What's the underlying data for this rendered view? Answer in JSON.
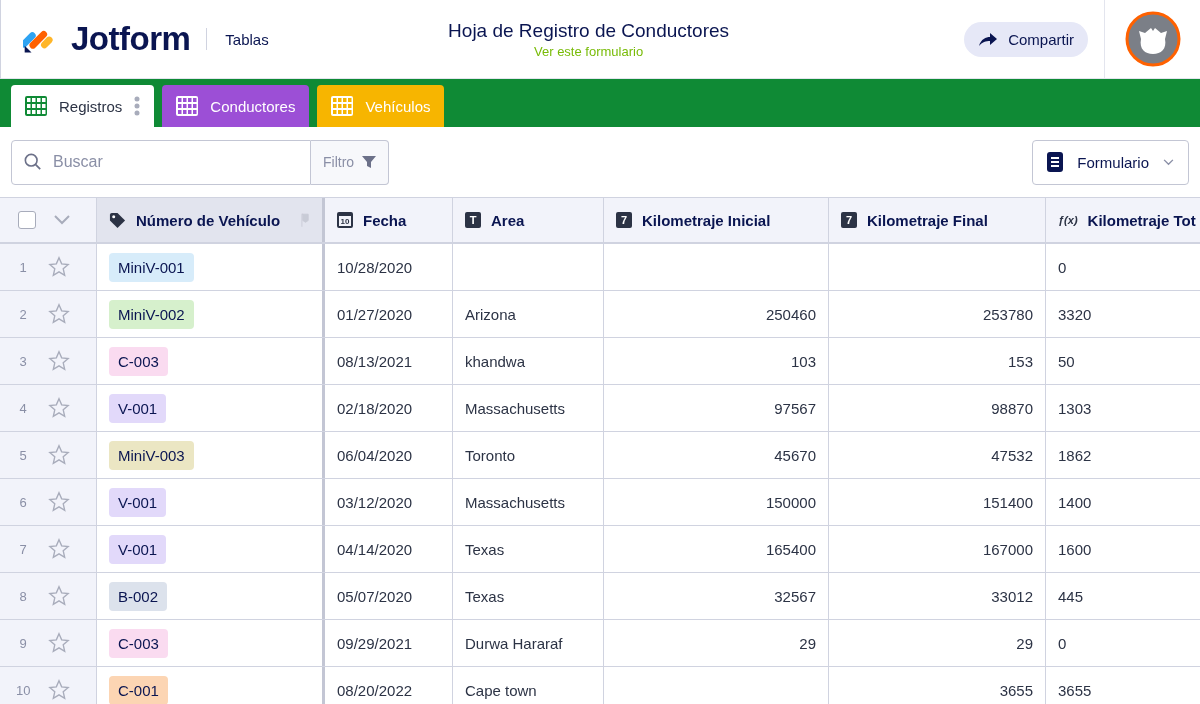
{
  "header": {
    "brand": "Jotform",
    "section": "Tablas",
    "title": "Hoja de Registro de Conductores",
    "subtitle_link": "Ver este formulario",
    "share_button": "Compartir"
  },
  "tabs": [
    {
      "label": "Registros",
      "selected": true,
      "color": "#ffffff"
    },
    {
      "label": "Conductores",
      "selected": false,
      "color": "#9c4fd6"
    },
    {
      "label": "Vehículos",
      "selected": false,
      "color": "#f7b500"
    }
  ],
  "toolbar": {
    "search_placeholder": "Buscar",
    "filter_button": "Filtro",
    "view_button": "Formulario"
  },
  "table": {
    "select_all_checked": false,
    "columns": [
      {
        "label": "Número de Vehículo",
        "kind": "tag"
      },
      {
        "label": "Fecha",
        "kind": "date",
        "glyph": "10"
      },
      {
        "label": "Area",
        "kind": "text",
        "glyph": "T"
      },
      {
        "label": "Kilometraje Inicial",
        "kind": "number",
        "glyph": "7"
      },
      {
        "label": "Kilometraje Final",
        "kind": "number",
        "glyph": "7"
      },
      {
        "label": "Kilometraje Tot",
        "kind": "formula",
        "glyph": "ƒ(x)"
      }
    ],
    "rows": [
      {
        "index": "1",
        "starred": false,
        "vehicle": "MiniV-001",
        "color": "#d7ecfa",
        "fecha": "10/28/2020",
        "area": "",
        "km_inicial": "",
        "km_final": "",
        "km_total": "0"
      },
      {
        "index": "2",
        "starred": false,
        "vehicle": "MiniV-002",
        "color": "#d6f0cc",
        "fecha": "01/27/2020",
        "area": "Arizona",
        "km_inicial": "250460",
        "km_final": "253780",
        "km_total": "3320"
      },
      {
        "index": "3",
        "starred": false,
        "vehicle": "C-003",
        "color": "#fadbf0",
        "fecha": "08/13/2021",
        "area": "khandwa",
        "km_inicial": "103",
        "km_final": "153",
        "km_total": "50"
      },
      {
        "index": "4",
        "starred": false,
        "vehicle": "V-001",
        "color": "#e2d9fa",
        "fecha": "02/18/2020",
        "area": "Massachusetts",
        "km_inicial": "97567",
        "km_final": "98870",
        "km_total": "1303"
      },
      {
        "index": "5",
        "starred": false,
        "vehicle": "MiniV-003",
        "color": "#ebe6c3",
        "fecha": "06/04/2020",
        "area": "Toronto",
        "km_inicial": "45670",
        "km_final": "47532",
        "km_total": "1862"
      },
      {
        "index": "6",
        "starred": false,
        "vehicle": "V-001",
        "color": "#e2d9fa",
        "fecha": "03/12/2020",
        "area": "Massachusetts",
        "km_inicial": "150000",
        "km_final": "151400",
        "km_total": "1400"
      },
      {
        "index": "7",
        "starred": false,
        "vehicle": "V-001",
        "color": "#e2d9fa",
        "fecha": "04/14/2020",
        "area": "Texas",
        "km_inicial": "165400",
        "km_final": "167000",
        "km_total": "1600"
      },
      {
        "index": "8",
        "starred": false,
        "vehicle": "B-002",
        "color": "#dce2ec",
        "fecha": "05/07/2020",
        "area": "Texas",
        "km_inicial": "32567",
        "km_final": "33012",
        "km_total": "445"
      },
      {
        "index": "9",
        "starred": false,
        "vehicle": "C-003",
        "color": "#fadbf0",
        "fecha": "09/29/2021",
        "area": "Durwa Hararaf",
        "km_inicial": "29",
        "km_final": "29",
        "km_total": "0"
      },
      {
        "index": "10",
        "starred": false,
        "vehicle": "C-001",
        "color": "#fcd5b3",
        "fecha": "08/20/2022",
        "area": "Cape town",
        "km_inicial": "",
        "km_final": "3655",
        "km_total": "3655"
      }
    ]
  }
}
